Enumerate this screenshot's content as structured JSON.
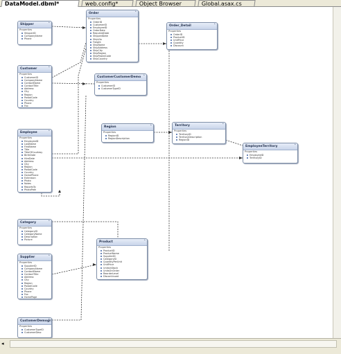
{
  "tabs": [
    {
      "label": "DataModel.dbml*",
      "active": true
    },
    {
      "label": "web.config*",
      "active": false
    },
    {
      "label": "Object Browser",
      "active": false
    },
    {
      "label": "Global.asax.cs",
      "active": false
    }
  ],
  "entities": {
    "shipper": {
      "name": "Shipper",
      "section": "Properties",
      "props": [
        "ShipperID",
        "CompanyName",
        "Phone"
      ]
    },
    "order": {
      "name": "Order",
      "section": "Properties",
      "props": [
        "OrderID",
        "CustomerID",
        "EmployeeID",
        "OrderDate",
        "RequiredDate",
        "ShippedDate",
        "ShipVia",
        "Freight",
        "ShipName",
        "ShipAddress",
        "ShipCity",
        "ShipRegion",
        "ShipPostalCode",
        "ShipCountry"
      ]
    },
    "order_detail": {
      "name": "Order_Detail",
      "section": "Properties",
      "props": [
        "OrderID",
        "ProductID",
        "UnitPrice",
        "Quantity",
        "Discount"
      ]
    },
    "customer": {
      "name": "Customer",
      "section": "Properties",
      "props": [
        "CustomerID",
        "CompanyName",
        "ContactName",
        "ContactTitle",
        "Address",
        "City",
        "Region",
        "PostalCode",
        "Country",
        "Phone",
        "Fax"
      ]
    },
    "customer_customer_demo": {
      "name": "CustomerCustomerDemo",
      "section": "Properties",
      "props": [
        "CustomerID",
        "CustomerTypeID"
      ]
    },
    "region": {
      "name": "Region",
      "section": "Properties",
      "props": [
        "RegionID",
        "RegionDescription"
      ]
    },
    "territory": {
      "name": "Territory",
      "section": "Properties",
      "props": [
        "TerritoryID",
        "TerritoryDescription",
        "RegionID"
      ]
    },
    "employee_territory": {
      "name": "EmployeeTerritory",
      "section": "Properties",
      "props": [
        "EmployeeID",
        "TerritoryID"
      ]
    },
    "employee": {
      "name": "Employee",
      "section": "Properties",
      "props": [
        "EmployeeID",
        "LastName",
        "FirstName",
        "Title",
        "TitleOfCourtesy",
        "BirthDate",
        "HireDate",
        "Address",
        "City",
        "Region",
        "PostalCode",
        "Country",
        "HomePhone",
        "Extension",
        "Photo",
        "Notes",
        "ReportsTo",
        "PhotoPath"
      ]
    },
    "category": {
      "name": "Category",
      "section": "Properties",
      "props": [
        "CategoryID",
        "CategoryName",
        "Description",
        "Picture"
      ]
    },
    "product": {
      "name": "Product",
      "section": "Properties",
      "props": [
        "ProductID",
        "ProductName",
        "SupplierID",
        "CategoryID",
        "QuantityPerUnit",
        "UnitPrice",
        "UnitsInStock",
        "UnitsOnOrder",
        "ReorderLevel",
        "Discontinued"
      ]
    },
    "supplier": {
      "name": "Supplier",
      "section": "Properties",
      "props": [
        "SupplierID",
        "CompanyName",
        "ContactName",
        "ContactTitle",
        "Address",
        "City",
        "Region",
        "PostalCode",
        "Country",
        "Phone",
        "Fax",
        "HomePage"
      ]
    },
    "customer_demographic": {
      "name": "CustomerDemographic",
      "section": "Properties",
      "props": [
        "CustomerTypeID",
        "CustomerDesc"
      ]
    }
  },
  "scrollbar": {
    "left_arrow": "◂"
  }
}
